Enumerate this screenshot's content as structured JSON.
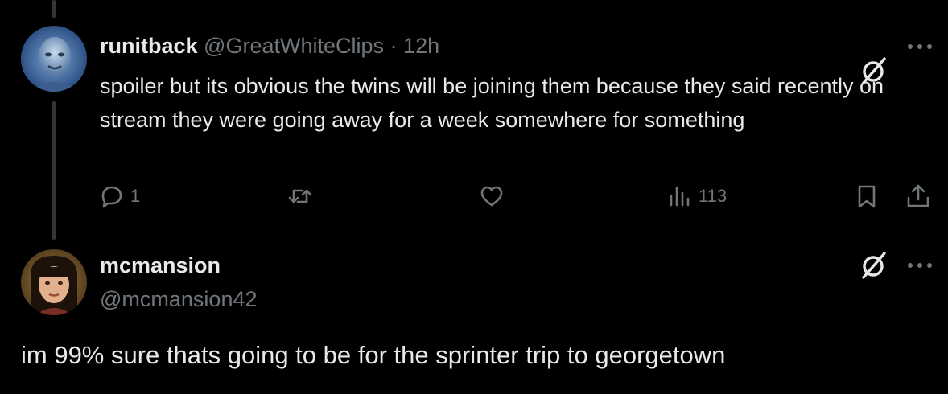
{
  "tweet": {
    "display_name": "runitback",
    "handle": "@GreatWhiteClips",
    "separator": "·",
    "time": "12h",
    "text": "spoiler but its obvious the twins will be joining them because they said recently on stream they were going away for a week somewhere for something",
    "avatar_icon": "bald-man-avatar",
    "actions": {
      "reply_count": "1",
      "retweet_count": "",
      "like_count": "",
      "views_count": "113"
    }
  },
  "reply": {
    "display_name": "mcmansion",
    "handle": "@mcmansion42",
    "text": "im 99% sure thats going to be for the sprinter trip to georgetown",
    "avatar_icon": "woman-bangs-avatar"
  },
  "icons": {
    "grok": "grok-icon",
    "more": "more-dots-icon",
    "reply": "reply-bubble-icon",
    "retweet": "retweet-icon",
    "like": "heart-icon",
    "views": "views-chart-icon",
    "bookmark": "bookmark-icon",
    "share": "share-icon"
  },
  "colors": {
    "background": "#000000",
    "primary_text": "#e7e9ea",
    "secondary_text": "#71767b",
    "thread_line": "#333639"
  }
}
